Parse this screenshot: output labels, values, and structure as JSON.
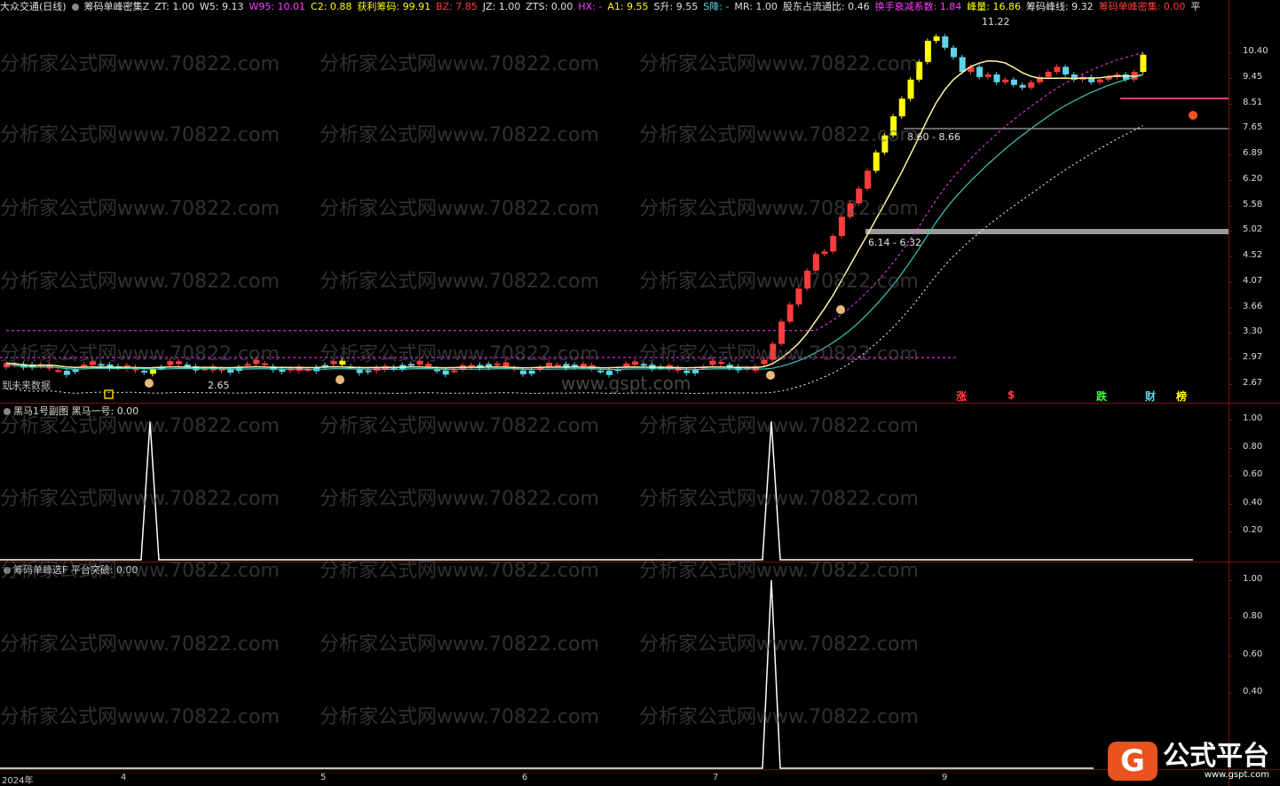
{
  "main_header": {
    "stock": "大众交通(日线)",
    "indicator": "筹码单峰密集Z",
    "items": [
      {
        "text": "ZT: 1.00",
        "color": "#e0e0e0"
      },
      {
        "text": "W5: 9.13",
        "color": "#e0e0e0"
      },
      {
        "text": "W95: 10.01",
        "color": "#ff3cff"
      },
      {
        "text": "C2: 0.88",
        "color": "#ffff00"
      },
      {
        "text": "获利筹码: 99.91",
        "color": "#ffff00"
      },
      {
        "text": "BZ: 7.85",
        "color": "#ff3c3c"
      },
      {
        "text": "JZ: 1.00",
        "color": "#e0e0e0"
      },
      {
        "text": "ZTS: 0.00",
        "color": "#e0e0e0"
      },
      {
        "text": "HX: -",
        "color": "#ff3cff"
      },
      {
        "text": "A1: 9.55",
        "color": "#ffff00"
      },
      {
        "text": "S升: 9.55",
        "color": "#e0e0e0"
      },
      {
        "text": "S降: -",
        "color": "#5fd3e8"
      },
      {
        "text": "MR: 1.00",
        "color": "#e0e0e0"
      },
      {
        "text": "股东占流通比: 0.46",
        "color": "#e0e0e0"
      },
      {
        "text": "换手衰减系数: 1.84",
        "color": "#ff3cff"
      },
      {
        "text": "峰量: 16.86",
        "color": "#ffff00"
      },
      {
        "text": "筹码峰线: 9.32",
        "color": "#e0e0e0"
      },
      {
        "text": "筹码单峰密集: 0.00",
        "color": "#ff3c3c"
      },
      {
        "text": "平",
        "color": "#e0e0e0"
      }
    ]
  },
  "main_axis": [
    "10.40",
    "9.45",
    "8.51",
    "7.65",
    "6.89",
    "6.20",
    "5.58",
    "5.02",
    "4.52",
    "4.07",
    "3.66",
    "3.30",
    "2.97",
    "2.67"
  ],
  "main_labels": {
    "peak": "11.22",
    "range_high": "8.60 - 8.66",
    "range_mid": "6.14 - 6.32",
    "low": "2.65",
    "nofuture": "到未来数据"
  },
  "signal_chars": [
    {
      "text": "涨",
      "color": "#ff4040"
    },
    {
      "text": "$",
      "color": "#ff4040"
    },
    {
      "text": "跌",
      "color": "#3cff3c"
    },
    {
      "text": "财",
      "color": "#5fd3e8"
    },
    {
      "text": "榜",
      "color": "#ffff00"
    }
  ],
  "watermark": {
    "site": "分析家公式网www.70822.com",
    "gspt": "www.gspt.com"
  },
  "sub1": {
    "title": "黑马1号副图",
    "value": "黑马一号: 0.00",
    "axis": [
      "1.00",
      "0.80",
      "0.60",
      "0.40",
      "0.20"
    ]
  },
  "sub2": {
    "title": "筹码单峰选F",
    "value": "平台突破: 0.00",
    "axis": [
      "1.00",
      "0.80",
      "0.60",
      "0.40"
    ]
  },
  "time_axis": [
    "2024年",
    "4",
    "5",
    "6",
    "7",
    "9"
  ],
  "logo": {
    "glyph": "G",
    "name": "公式平台",
    "url": "www.gspt.com"
  },
  "colors": {
    "up": "#ffff00",
    "down": "#5fd3e8",
    "small_up": "#ff3c3c",
    "ma_line": "#fffaa0",
    "ma2_line": "#3cc8b4",
    "grid_red": "#7a1010"
  }
}
